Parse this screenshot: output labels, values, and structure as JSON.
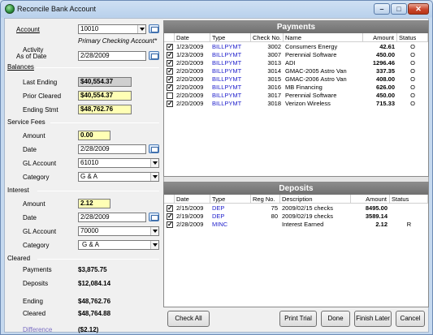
{
  "window": {
    "title": "Reconcile Bank Account"
  },
  "left": {
    "account_label": "Account",
    "account_value": "10010",
    "account_name": "Primary Checking Account*",
    "activity_label_1": "Activity",
    "activity_label_2": "As of Date",
    "activity_date": "2/28/2009",
    "balances_header": "Balances",
    "last_ending_label": "Last Ending",
    "last_ending_value": "$40,554.37",
    "prior_cleared_label": "Prior Cleared",
    "prior_cleared_value": "$40,554.37",
    "ending_stmt_label": "Ending Stmt",
    "ending_stmt_value": "$48,762.76",
    "service_fees_header": "Service Fees",
    "sf_amount_label": "Amount",
    "sf_amount_value": "0.00",
    "sf_date_label": "Date",
    "sf_date_value": "2/28/2009",
    "sf_gl_label": "GL Account",
    "sf_gl_value": "61010",
    "sf_category_label": "Category",
    "sf_category_value": "G & A",
    "interest_header": "Interest",
    "int_amount_label": "Amount",
    "int_amount_value": "2.12",
    "int_date_label": "Date",
    "int_date_value": "2/28/2009",
    "int_gl_label": "GL Account",
    "int_gl_value": "70000",
    "int_category_label": "Category",
    "int_category_value": "G & A",
    "cleared_header": "Cleared",
    "payments_label": "Payments",
    "payments_value": "$3,875.75",
    "deposits_label": "Deposits",
    "deposits_value": "$12,084.14",
    "ending_label": "Ending",
    "ending_value": "$48,762.76",
    "cleared_label": "Cleared",
    "cleared_value": "$48,764.88",
    "difference_label": "Difference",
    "difference_value": "($2.12)"
  },
  "payments": {
    "title": "Payments",
    "headers": [
      "Date",
      "Type",
      "Check No.",
      "Name",
      "Amount",
      "Status"
    ],
    "rows": [
      {
        "checked": true,
        "date": "1/23/2009",
        "type": "BILLPYMT",
        "check_no": "3002",
        "name": "Consumers Energy",
        "amount": "42.61",
        "status": "O"
      },
      {
        "checked": true,
        "date": "1/23/2009",
        "type": "BILLPYMT",
        "check_no": "3007",
        "name": "Perennial Software",
        "amount": "450.00",
        "status": "O"
      },
      {
        "checked": true,
        "date": "2/20/2009",
        "type": "BILLPYMT",
        "check_no": "3013",
        "name": "ADI",
        "amount": "1296.46",
        "status": "O"
      },
      {
        "checked": true,
        "date": "2/20/2009",
        "type": "BILLPYMT",
        "check_no": "3014",
        "name": "GMAC-2005 Astro Van",
        "amount": "337.35",
        "status": "O"
      },
      {
        "checked": true,
        "date": "2/20/2009",
        "type": "BILLPYMT",
        "check_no": "3015",
        "name": "GMAC-2006 Astro Van",
        "amount": "408.00",
        "status": "O"
      },
      {
        "checked": true,
        "date": "2/20/2009",
        "type": "BILLPYMT",
        "check_no": "3016",
        "name": "MB Financing",
        "amount": "626.00",
        "status": "O"
      },
      {
        "checked": false,
        "date": "2/20/2009",
        "type": "BILLPYMT",
        "check_no": "3017",
        "name": "Perennial Software",
        "amount": "450.00",
        "status": "O"
      },
      {
        "checked": true,
        "date": "2/20/2009",
        "type": "BILLPYMT",
        "check_no": "3018",
        "name": "Verizon Wireless",
        "amount": "715.33",
        "status": "O"
      }
    ]
  },
  "deposits": {
    "title": "Deposits",
    "headers": [
      "Date",
      "Type",
      "Reg No.",
      "Description",
      "Amount",
      "Status"
    ],
    "rows": [
      {
        "checked": true,
        "date": "2/15/2009",
        "type": "DEP",
        "reg_no": "75",
        "description": "2009/02/15 checks",
        "amount": "8495.00",
        "status": ""
      },
      {
        "checked": true,
        "date": "2/19/2009",
        "type": "DEP",
        "reg_no": "80",
        "description": "2009/02/19 checks",
        "amount": "3589.14",
        "status": ""
      },
      {
        "checked": true,
        "date": "2/28/2009",
        "type": "MINC",
        "reg_no": "",
        "description": "Interest Earned",
        "amount": "2.12",
        "status": "R"
      }
    ]
  },
  "buttons": {
    "check_all": "Check All",
    "print_trial": "Print Trial",
    "done": "Done",
    "finish_later": "Finish Later",
    "cancel": "Cancel"
  }
}
